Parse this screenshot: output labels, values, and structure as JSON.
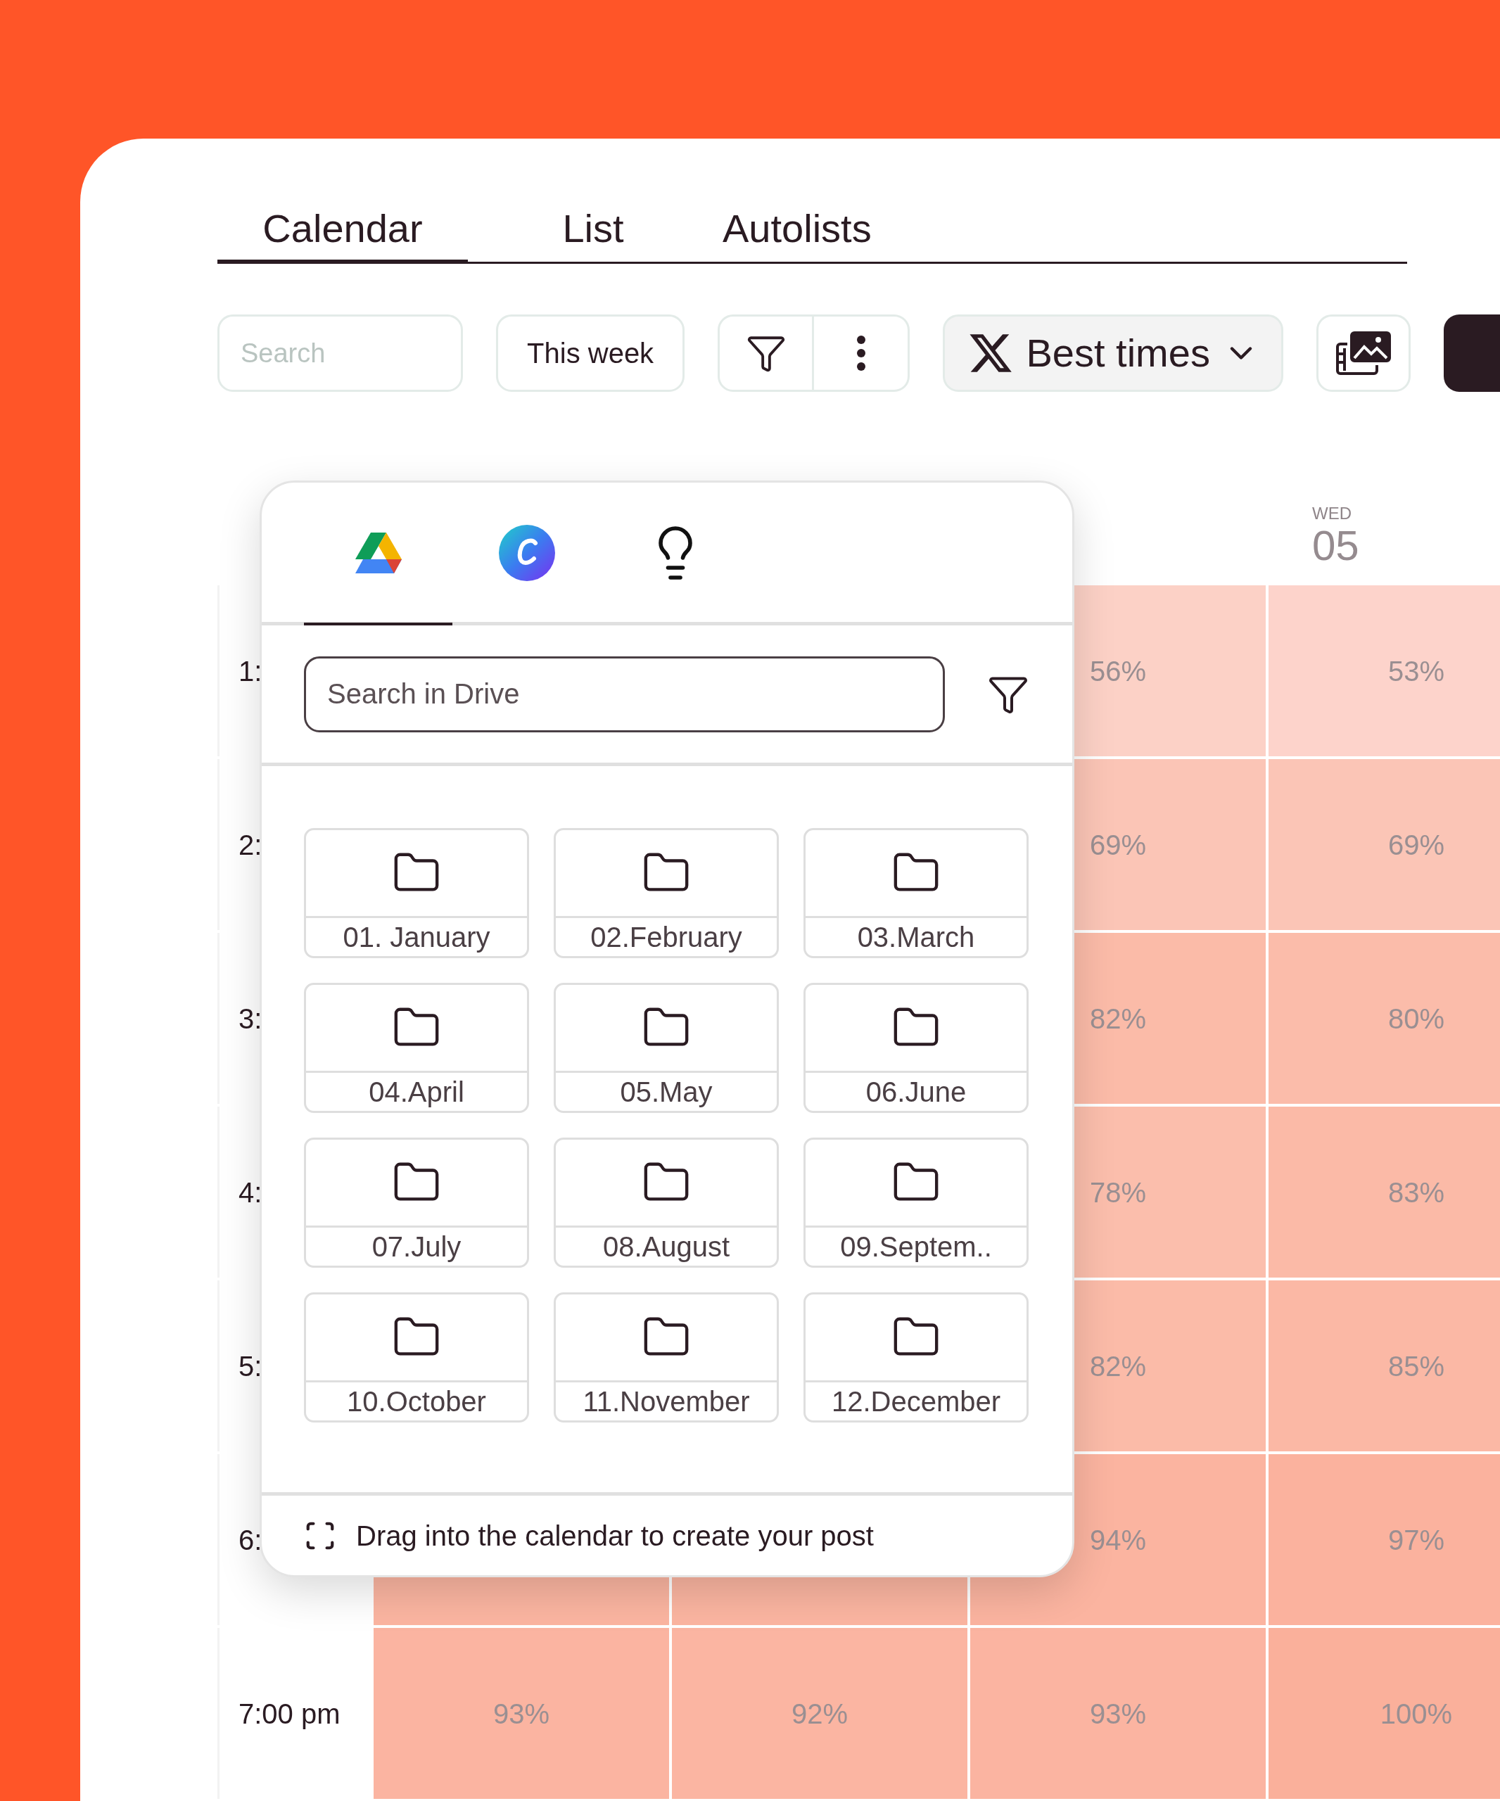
{
  "tabs": [
    {
      "label": "Calendar",
      "selected": true
    },
    {
      "label": "List",
      "selected": false
    },
    {
      "label": "Autolists",
      "selected": false
    }
  ],
  "toolbar": {
    "search": {
      "placeholder": "Search"
    },
    "range_button": "This week",
    "network_button": {
      "label": "Best times"
    }
  },
  "calendar": {
    "day_header": {
      "weekday": "WED",
      "day": "05"
    },
    "rows": [
      {
        "time": "1:",
        "cells": [
          {
            "text": "56%",
            "color": "#fcd1c6"
          },
          {
            "text": "53%",
            "color": "#fdd3cb"
          }
        ]
      },
      {
        "time": "2:",
        "cells": [
          {
            "text": "69%",
            "color": "#fbc5b6"
          },
          {
            "text": "69%",
            "color": "#fbc5b6"
          }
        ]
      },
      {
        "time": "3:",
        "cells": [
          {
            "text": "82%",
            "color": "#fbbba8"
          },
          {
            "text": "80%",
            "color": "#fbbcaa"
          }
        ]
      },
      {
        "time": "4:",
        "cells": [
          {
            "text": "78%",
            "color": "#fbbeac"
          },
          {
            "text": "83%",
            "color": "#fbbaa7"
          }
        ]
      },
      {
        "time": "5:",
        "cells": [
          {
            "text": "82%",
            "color": "#fbbba8"
          },
          {
            "text": "85%",
            "color": "#fbb8a5"
          }
        ]
      },
      {
        "time": "6:",
        "cells": [
          {
            "color": "#fbb5a1"
          },
          {
            "color": "#fbb5a1"
          },
          {
            "text": "94%",
            "color": "#fbb4a0"
          },
          {
            "text": "97%",
            "color": "#fbb29e"
          }
        ]
      },
      {
        "time": "7:00 pm",
        "cells": [
          {
            "text": "93%",
            "color": "#fbb4a1"
          },
          {
            "text": "92%",
            "color": "#fbb5a2"
          },
          {
            "text": "93%",
            "color": "#fbb4a1"
          },
          {
            "text": "100%",
            "color": "#fab09b"
          }
        ]
      }
    ]
  },
  "media_panel": {
    "sources": [
      {
        "kind": "drive",
        "selected": true
      },
      {
        "kind": "canva",
        "selected": false
      },
      {
        "kind": "ideas",
        "selected": false
      }
    ],
    "search": {
      "placeholder": "Search in Drive"
    },
    "folders": [
      "01. January",
      "02.February",
      "03.March",
      "04.April",
      "05.May",
      "06.June",
      "07.July",
      "08.August",
      "09.Septem..",
      "10.October",
      "11.November",
      "12.December"
    ],
    "hint": "Drag into the calendar to create your post"
  }
}
